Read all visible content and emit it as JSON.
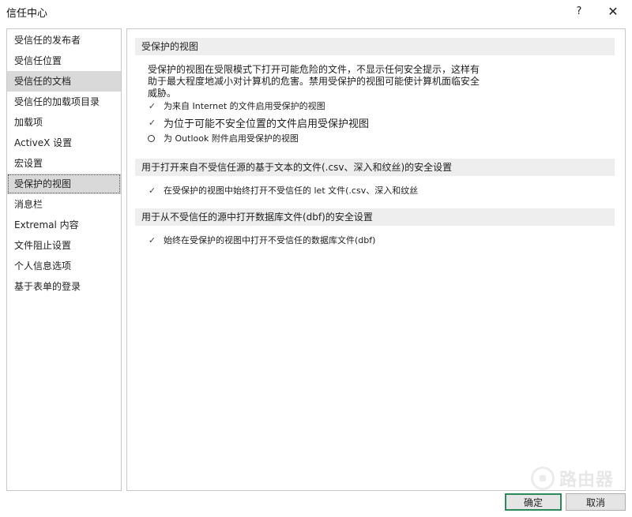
{
  "window": {
    "title": "信任中心",
    "help_label": "?",
    "close_label": "✕"
  },
  "sidebar": {
    "items": [
      {
        "label": "受信任的发布者"
      },
      {
        "label": "受信任位置"
      },
      {
        "label": "受信任的文档"
      },
      {
        "label": "受信任的加载项目录"
      },
      {
        "label": "加载项"
      },
      {
        "label": "ActiveX 设置"
      },
      {
        "label": "宏设置"
      },
      {
        "label": "受保护的视图"
      },
      {
        "label": "消息栏"
      },
      {
        "label": "Extremal 内容"
      },
      {
        "label": "文件阻止设置"
      },
      {
        "label": "个人信息选项"
      },
      {
        "label": "基于表单的登录"
      }
    ],
    "selected_index": 7
  },
  "protected_view": {
    "header": "受保护的视图",
    "description": "受保护的视图在受限模式下打开可能危险的文件，不显示任何安全提示，这样有助于最大程度地减小对计算机的危害。禁用受保护的视图可能使计算机面临安全威胁。",
    "options": [
      {
        "label": "为来自 Internet 的文件启用受保护的视图",
        "checked": true
      },
      {
        "label": "为位于可能不安全位置的文件启用受保护视图",
        "checked": true
      },
      {
        "label": "为 Outlook 附件启用受保护的视图",
        "checked": false
      }
    ]
  },
  "text_files": {
    "header": "用于打开来自不受信任源的基于文本的文件(.csv、深入和纹丝)的安全设置",
    "option_label": "在受保护的视图中始终打开不受信任的 let 文件(.csv、深入和纹丝",
    "checked": true
  },
  "dbf_files": {
    "header": "用于从不受信任的源中打开数据库文件(dbf)的安全设置",
    "option_label": "始终在受保护的视图中打开不受信任的数据库文件(dbf)",
    "checked": true
  },
  "footer": {
    "ok_label": "确定",
    "cancel_label": "取消"
  },
  "watermark": {
    "text": "路由器",
    "icon": "router-logo-icon"
  },
  "icons": {
    "checkmark": "✓"
  },
  "colors": {
    "primary_button_border": "#2b8a5a",
    "section_header_bg": "#eeeeee",
    "selection_bg": "#d9d9d9"
  }
}
